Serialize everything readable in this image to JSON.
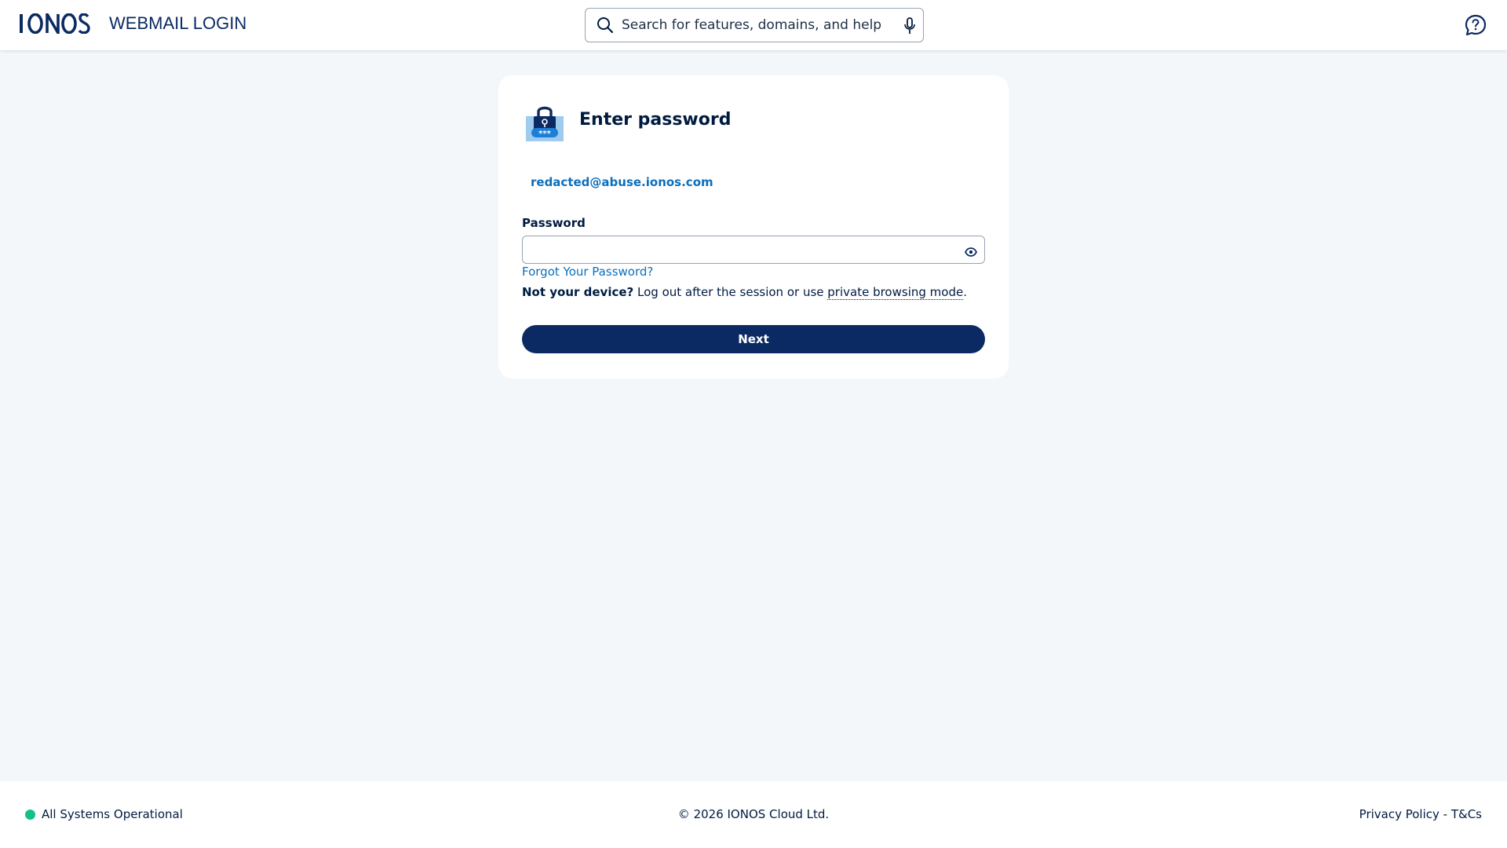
{
  "header": {
    "logo_alt": "IONOS",
    "title": "WEBMAIL LOGIN",
    "search_placeholder": "Search for features, domains, and help",
    "icons": [
      "search-icon",
      "microphone-icon",
      "help-chat-icon"
    ]
  },
  "login": {
    "title": "Enter password",
    "email": "redacted@abuse.ionos.com",
    "password_label": "Password",
    "password_value": "",
    "forgot_link": "Forgot Your Password?",
    "device_note_bold": "Not your device?",
    "device_note_text": " Log out after the session or use ",
    "device_note_link": "private browsing mode",
    "device_note_end": ".",
    "next_button": "Next",
    "icons": [
      "lock-password-icon",
      "eye-icon"
    ]
  },
  "footer": {
    "status": "All Systems Operational",
    "copyright": "© 2026 IONOS Cloud Ltd.",
    "privacy": "Privacy Policy",
    "separator": " - ",
    "terms": "T&Cs"
  },
  "colors": {
    "brand_navy": "#0b2a63",
    "link_blue": "#0b6fbd",
    "status_green": "#13c08a",
    "background": "#f4f7fa"
  }
}
